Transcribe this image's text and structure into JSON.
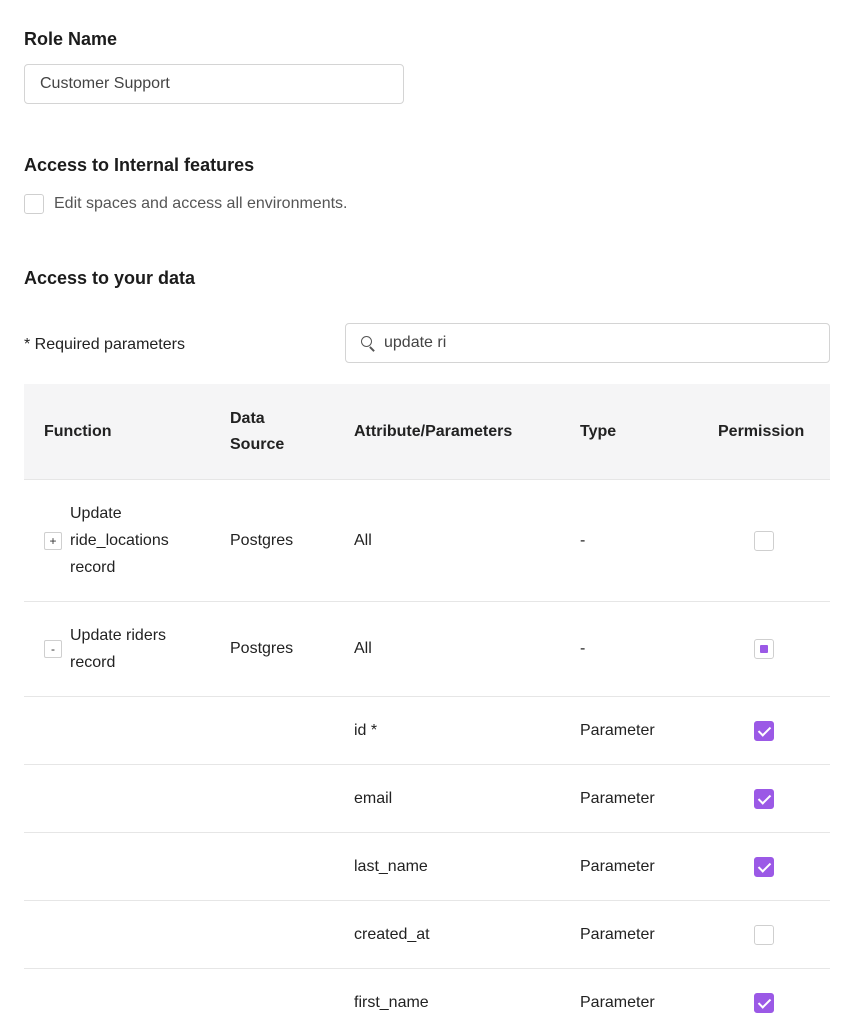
{
  "role": {
    "title": "Role Name",
    "value": "Customer Support"
  },
  "internal": {
    "title": "Access to Internal features",
    "checkbox_label": "Edit spaces and access all environments.",
    "checked": false
  },
  "data_access": {
    "title": "Access to your data",
    "required_note": "* Required parameters",
    "search_value": "update ri"
  },
  "table": {
    "headers": {
      "function": "Function",
      "data_source_line1": "Data",
      "data_source_line2": "Source",
      "attribute": "Attribute/Parameters",
      "type": "Type",
      "permission": "Permission"
    },
    "rows": [
      {
        "expander": "+",
        "function_line1": "Update",
        "function_line2": "ride_locations",
        "function_line3": "record",
        "source": "Postgres",
        "attribute": "All",
        "type": "-",
        "permission": "unchecked"
      },
      {
        "expander": "-",
        "function_line1": "Update riders",
        "function_line2": "record",
        "source": "Postgres",
        "attribute": "All",
        "type": "-",
        "permission": "partial"
      },
      {
        "attribute": "id *",
        "type": "Parameter",
        "permission": "checked"
      },
      {
        "attribute": "email",
        "type": "Parameter",
        "permission": "checked"
      },
      {
        "attribute": "last_name",
        "type": "Parameter",
        "permission": "checked"
      },
      {
        "attribute": "created_at",
        "type": "Parameter",
        "permission": "unchecked"
      },
      {
        "attribute": "first_name",
        "type": "Parameter",
        "permission": "checked"
      }
    ]
  },
  "colors": {
    "accent": "#9b59e6",
    "header_bg": "#f5f5f6",
    "border": "#d4d4d4"
  }
}
